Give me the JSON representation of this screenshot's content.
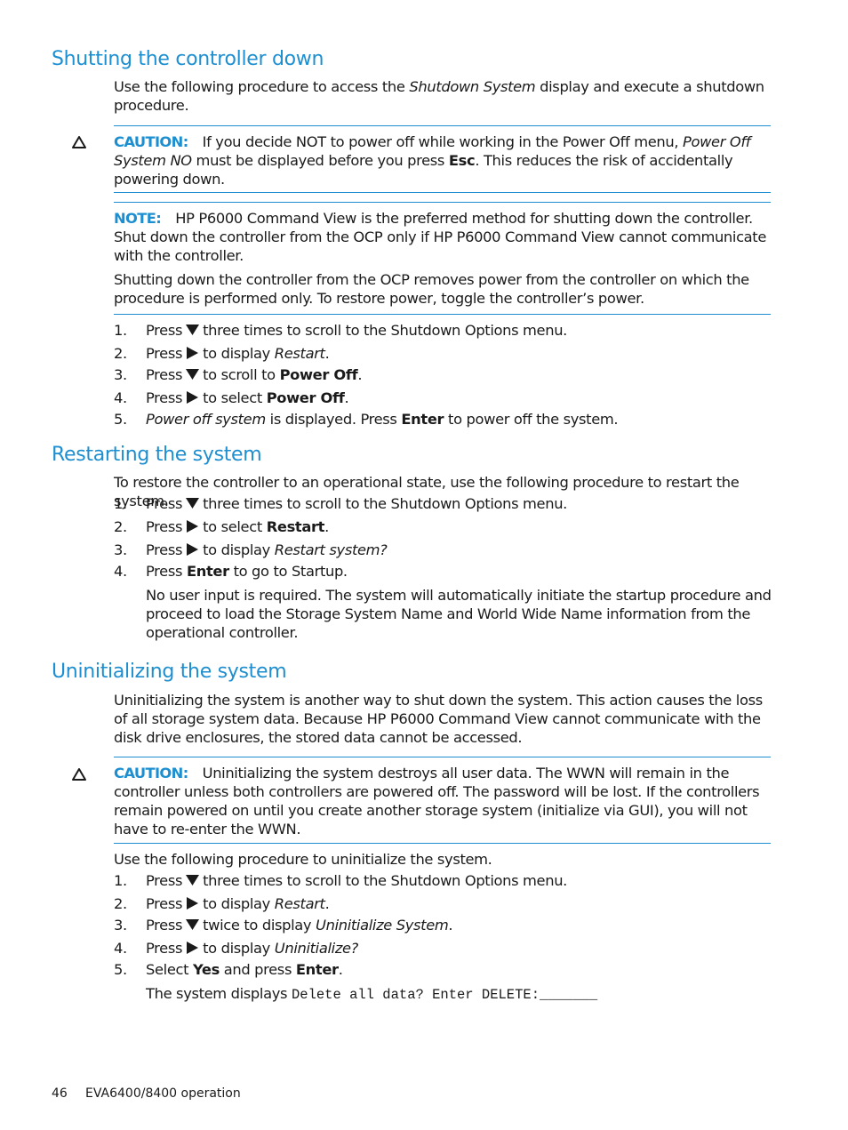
{
  "sections": {
    "shutdown": {
      "heading": "Shutting the controller down",
      "intro_a": "Use the following procedure to access the ",
      "intro_em": "Shutdown System",
      "intro_b": " display and execute a shutdown procedure.",
      "caution": {
        "label": "CAUTION:",
        "text_a": "If you decide NOT to power off while working in the Power Off menu, ",
        "text_em": "Power Off System NO",
        "text_b": " must be displayed before you press ",
        "text_bold": "Esc",
        "text_c": ". This reduces the risk of accidentally powering down."
      },
      "note": {
        "label": "NOTE:",
        "text": "HP P6000 Command View is the preferred method for shutting down the controller. Shut down the controller from the OCP only if HP P6000 Command View cannot communicate with the controller.",
        "text2": "Shutting down the controller from the OCP removes power from the controller on which the procedure is performed only. To restore power, toggle the controller’s power."
      },
      "steps": [
        {
          "num": "1.",
          "pre": "Press",
          "icon": "down",
          "post": "three times to scroll to the Shutdown Options menu."
        },
        {
          "num": "2.",
          "pre": "Press",
          "icon": "right",
          "post": "to display ",
          "em": "Restart",
          "tail": "."
        },
        {
          "num": "3.",
          "pre": "Press",
          "icon": "down",
          "post": "to scroll to ",
          "bold": "Power Off",
          "tail": "."
        },
        {
          "num": "4.",
          "pre": "Press",
          "icon": "right",
          "post": "to select ",
          "bold": "Power Off",
          "tail": "."
        },
        {
          "num": "5.",
          "em": "Power off system",
          "post": " is displayed. Press ",
          "bold": "Enter",
          "tail": " to power off the system."
        }
      ]
    },
    "restart": {
      "heading": "Restarting the system",
      "intro": "To restore the controller to an operational state, use the following procedure to restart the system.",
      "steps": [
        {
          "num": "1.",
          "pre": "Press",
          "icon": "down",
          "post": "three times to scroll to the Shutdown Options menu."
        },
        {
          "num": "2.",
          "pre": "Press",
          "icon": "right",
          "post": "to select ",
          "bold": "Restart",
          "tail": "."
        },
        {
          "num": "3.",
          "pre": "Press",
          "icon": "right",
          "post": "to display ",
          "em": "Restart system?",
          "tail": ""
        },
        {
          "num": "4.",
          "pre": "Press ",
          "bold": "Enter",
          "post": " to go to Startup."
        }
      ],
      "followup": "No user input is required. The system will automatically initiate the startup procedure and proceed to load the Storage System Name and World Wide Name information from the operational controller."
    },
    "uninit": {
      "heading": "Uninitializing the system",
      "intro": "Uninitializing the system is another way to shut down the system. This action causes the loss of all storage system data. Because HP P6000 Command View cannot communicate with the disk drive enclosures, the stored data cannot be accessed.",
      "caution": {
        "label": "CAUTION:",
        "text": "Uninitializing the system destroys all user data. The WWN will remain in the controller unless both controllers are powered off. The password will be lost. If the controllers remain powered on until you create another storage system (initialize via GUI), you will not have to re-enter the WWN."
      },
      "lead": "Use the following procedure to uninitialize the system.",
      "steps": [
        {
          "num": "1.",
          "pre": "Press",
          "icon": "down",
          "post": "three times to scroll to the Shutdown Options menu."
        },
        {
          "num": "2.",
          "pre": "Press",
          "icon": "right",
          "post": "to display ",
          "em": "Restart",
          "tail": "."
        },
        {
          "num": "3.",
          "pre": "Press",
          "icon": "down",
          "post": "twice to display ",
          "em": "Uninitialize System",
          "tail": "."
        },
        {
          "num": "4.",
          "pre": "Press",
          "icon": "right",
          "post": "to display ",
          "em": "Uninitialize?",
          "tail": ""
        },
        {
          "num": "5.",
          "pre": "Select ",
          "bold": "Yes",
          "post": " and press ",
          "bold2": "Enter",
          "tail": "."
        }
      ],
      "display_text": "The system displays ",
      "display_code": "Delete all data? Enter DELETE:_______"
    }
  },
  "footer": {
    "page_number": "46",
    "doc_title": "EVA6400/8400 operation"
  },
  "colors": {
    "accent": "#1d8fd0",
    "text": "#1a1a1a"
  }
}
